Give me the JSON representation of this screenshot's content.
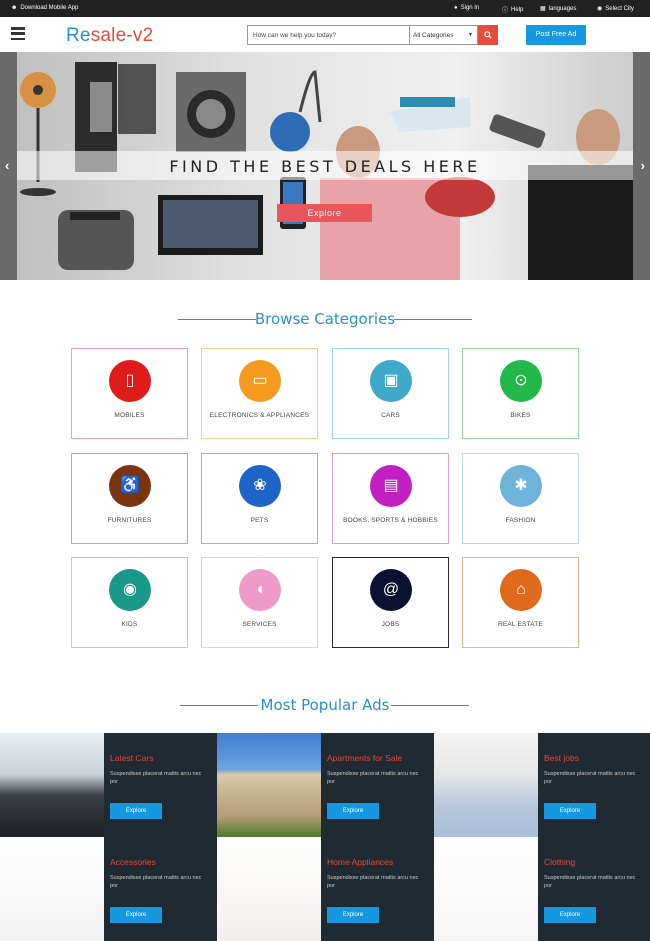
{
  "topbar": {
    "download_app": "Download Mobile App",
    "sign_in": "Sign In",
    "help": "Help",
    "languages": "languages",
    "select_city": "Select City"
  },
  "header": {
    "logo_accent": "Re",
    "logo_rest": "sale-v2",
    "search_placeholder": "How can we help you today?",
    "category_selected": "All Categories",
    "post_ad": "Post Free Ad"
  },
  "hero": {
    "title": "FIND THE BEST DEALS HERE",
    "explore": "Explore"
  },
  "categories": {
    "title": "Browse Categories",
    "items": [
      {
        "label": "MOBILES",
        "icon": "mobile-icon",
        "color": "#e01b1b",
        "border": "#e9a3b8"
      },
      {
        "label": "ELECTRONICS & APPLIANCES",
        "icon": "laptop-icon",
        "color": "#f39a1f",
        "border": "#f2cf8f"
      },
      {
        "label": "CARS",
        "icon": "car-icon",
        "color": "#3fa9c9",
        "border": "#9fd4e4"
      },
      {
        "label": "BIKES",
        "icon": "motorbike-icon",
        "color": "#22b84a",
        "border": "#9bd7a3"
      },
      {
        "label": "FURNITURES",
        "icon": "wheelchair-icon",
        "color": "#7a3410",
        "border": "#c7a58e"
      },
      {
        "label": "PETS",
        "icon": "paw-icon",
        "color": "#1e64c8",
        "border": "#8fb2e2"
      },
      {
        "label": "BOOKS, SPORTS & HOBBIES",
        "icon": "book-icon",
        "color": "#c21fc2",
        "border": "#df99df"
      },
      {
        "label": "FASHION",
        "icon": "asterisk-icon",
        "color": "#6eb3d9",
        "border": "#b9dcee"
      },
      {
        "label": "KIDS",
        "icon": "gamepad-icon",
        "color": "#1a998a",
        "border": "#9fd6cf"
      },
      {
        "label": "SERVICES",
        "icon": "shield-icon",
        "color": "#ee9ac6",
        "border": "#f4c9de"
      },
      {
        "label": "JOBS",
        "icon": "at-icon",
        "color": "#0d1030",
        "border": "#2b2b2b"
      },
      {
        "label": "REAL ESTATE",
        "icon": "home-icon",
        "color": "#e06a1c",
        "border": "#f0b487"
      }
    ]
  },
  "popular": {
    "title": "Most Popular Ads",
    "items": [
      {
        "title": "Latest Cars",
        "desc": "Suspendisse placerat mattis arcu nec por",
        "button": "Explore",
        "image": "car-image"
      },
      {
        "title": "Apartments for Sale",
        "desc": "Suspendisse placerat mattis arcu nec por",
        "button": "Explore",
        "image": "apartment-image"
      },
      {
        "title": "Best jobs",
        "desc": "Suspendisse placerat mattis arcu nec por",
        "button": "Explore",
        "image": "businessman-image"
      },
      {
        "title": "Accessories",
        "desc": "Suspendisse placerat mattis arcu nec por",
        "button": "Explore",
        "image": "headphones-image"
      },
      {
        "title": "Home Appliances",
        "desc": "Suspendisse placerat mattis arcu nec por",
        "button": "Explore",
        "image": "cookware-image"
      },
      {
        "title": "Clothing",
        "desc": "Suspendisse placerat mattis arcu nec por",
        "button": "Explore",
        "image": "shirt-image"
      }
    ]
  },
  "colors": {
    "accent": "#2a8fd0",
    "brand_red": "#e44b3c",
    "button_blue": "#1598df",
    "dark_bar": "#212121",
    "tile_bg": "#1f2a33"
  }
}
